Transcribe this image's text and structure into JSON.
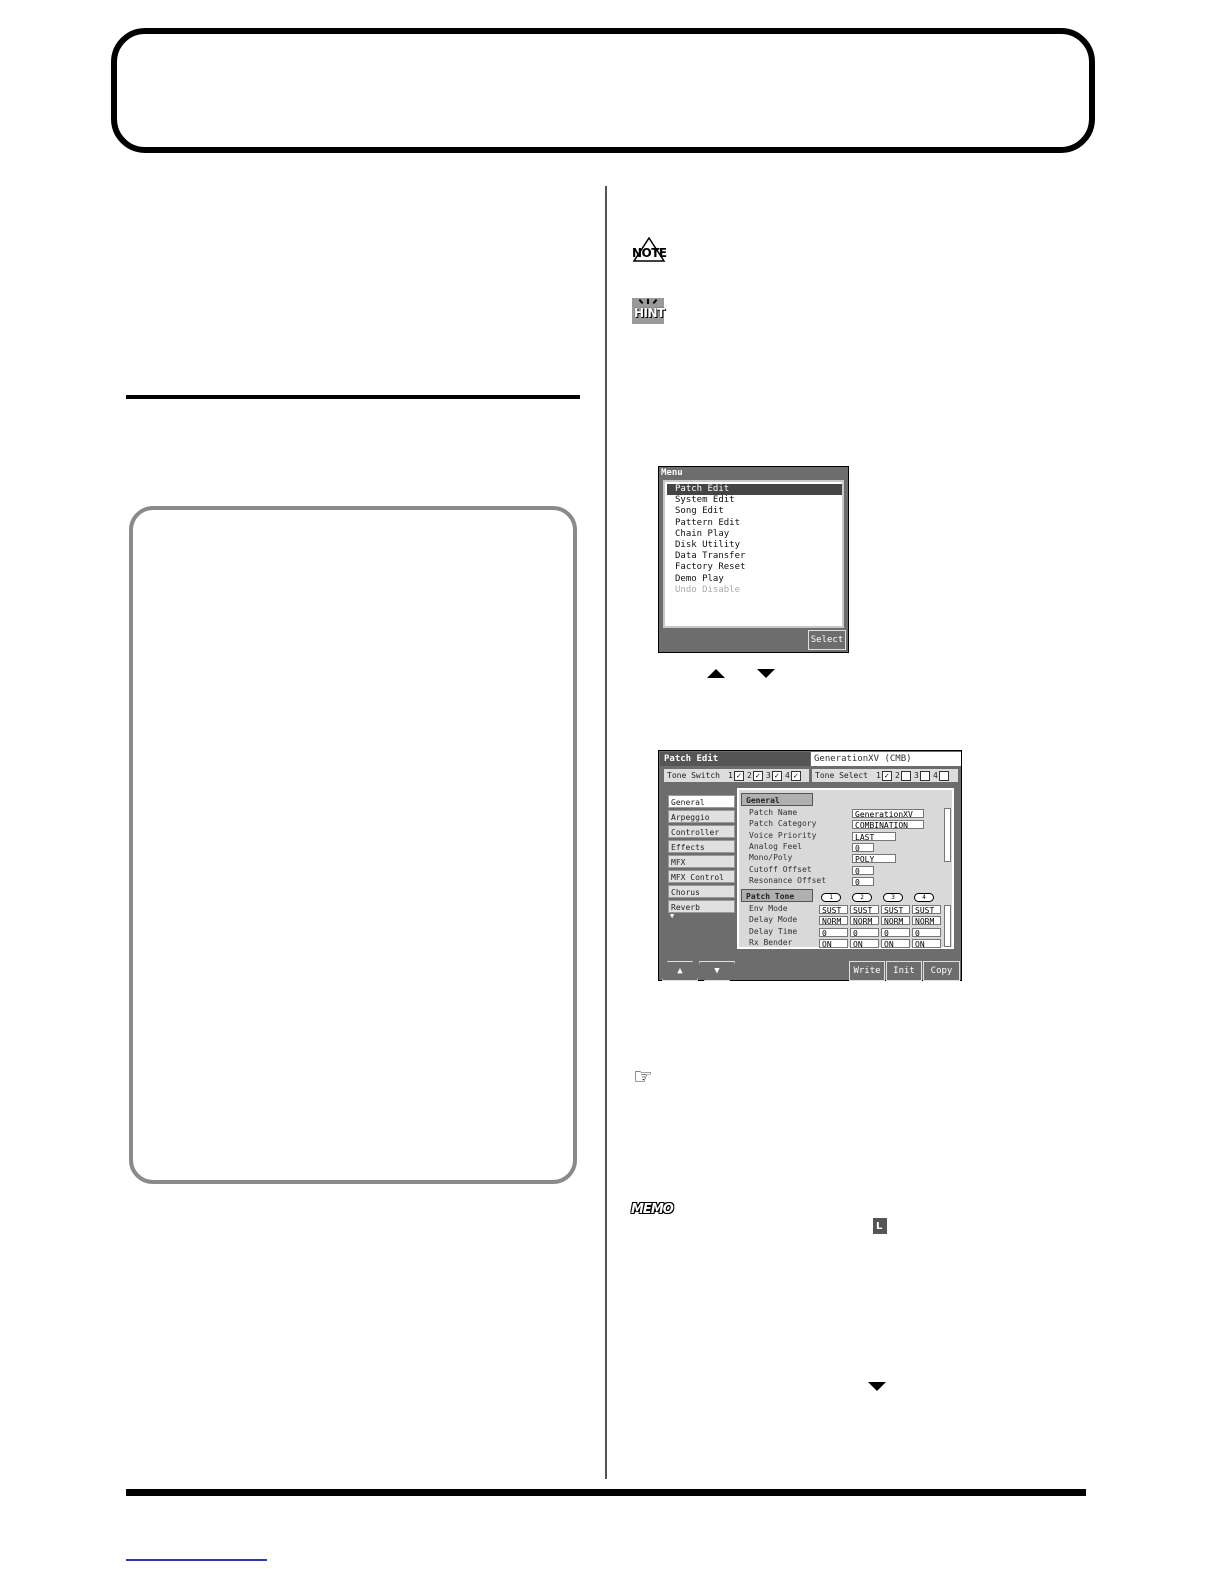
{
  "icons": {
    "note": "NOTE",
    "hint": "HINT",
    "reference": "☞",
    "memo": "MEMO",
    "l_key": "L"
  },
  "menu_screen": {
    "title": "Menu",
    "items": [
      {
        "label": "Patch Edit",
        "state": "selected"
      },
      {
        "label": "System Edit",
        "state": "normal"
      },
      {
        "label": "Song Edit",
        "state": "normal"
      },
      {
        "label": "Pattern Edit",
        "state": "normal"
      },
      {
        "label": "Chain Play",
        "state": "normal"
      },
      {
        "label": "Disk Utility",
        "state": "normal"
      },
      {
        "label": "Data Transfer",
        "state": "normal"
      },
      {
        "label": "Factory Reset",
        "state": "normal"
      },
      {
        "label": "Demo Play",
        "state": "normal"
      },
      {
        "label": "Undo Disable",
        "state": "disabled"
      }
    ],
    "select_button": "Select"
  },
  "patch_edit_screen": {
    "title": "Patch Edit",
    "patch_name": "GenerationXV (CMB)",
    "tone_switch_label": "Tone Switch",
    "tone_switch": [
      {
        "num": "1",
        "mark": "✓"
      },
      {
        "num": "2",
        "mark": "✓"
      },
      {
        "num": "3",
        "mark": "✓"
      },
      {
        "num": "4",
        "mark": "✓"
      }
    ],
    "tone_select_label": "Tone Select",
    "tone_select": [
      {
        "num": "1",
        "mark": "✓"
      },
      {
        "num": "2",
        "mark": ""
      },
      {
        "num": "3",
        "mark": ""
      },
      {
        "num": "4",
        "mark": ""
      }
    ],
    "tabs": [
      "General",
      "Arpeggio",
      "Controller",
      "Effects",
      "MFX",
      "MFX Control",
      "Chorus",
      "Reverb"
    ],
    "more_arrow": "▼",
    "general_header": "General",
    "general_params": [
      {
        "label": "Patch Name",
        "value": "GenerationXV"
      },
      {
        "label": "Patch Category",
        "value": "COMBINATION"
      },
      {
        "label": "Voice Priority",
        "value": "LAST"
      },
      {
        "label": "Analog Feel",
        "value": "0"
      },
      {
        "label": "Mono/Poly",
        "value": "POLY"
      },
      {
        "label": "Cutoff Offset",
        "value": "0"
      },
      {
        "label": "Resonance Offset",
        "value": "0"
      }
    ],
    "patch_tone_header": "Patch Tone",
    "tone_numbers": [
      "1",
      "2",
      "3",
      "4"
    ],
    "tone_params": [
      {
        "label": "Env Mode",
        "values": [
          "SUST",
          "SUST",
          "SUST",
          "SUST"
        ]
      },
      {
        "label": "Delay Mode",
        "values": [
          "NORM",
          "NORM",
          "NORM",
          "NORM"
        ]
      },
      {
        "label": "Delay Time",
        "values": [
          "0",
          "0",
          "0",
          "0"
        ]
      },
      {
        "label": "Rx Bender",
        "values": [
          "ON",
          "ON",
          "ON",
          "ON"
        ]
      }
    ],
    "up_button": "▲",
    "down_button": "▼",
    "write_button": "Write",
    "init_button": "Init",
    "copy_button": "Copy"
  }
}
